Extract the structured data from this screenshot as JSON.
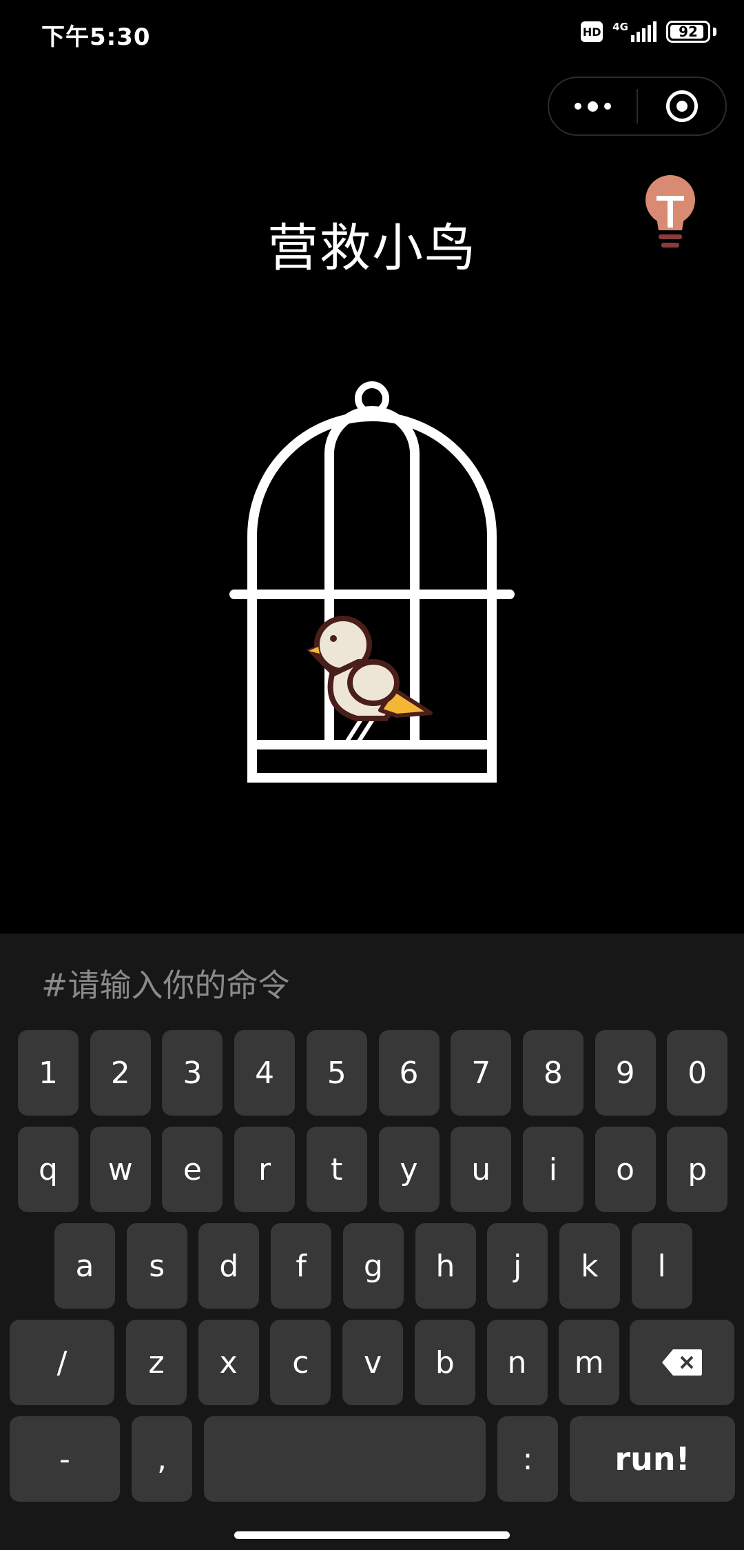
{
  "status_bar": {
    "time": "下午5:30",
    "hd": "HD",
    "network": "4G",
    "battery": "92",
    "battery_fraction": 0.92
  },
  "capsule": {
    "menu_icon": "more-dots-icon",
    "close_icon": "target-circle-icon"
  },
  "hint_icon": "lightbulb-icon",
  "game": {
    "title": "营救小鸟",
    "illustration": "birdcage-icon"
  },
  "command": {
    "placeholder": "#请输入你的命令",
    "value": ""
  },
  "keyboard": {
    "row1": [
      "1",
      "2",
      "3",
      "4",
      "5",
      "6",
      "7",
      "8",
      "9",
      "0"
    ],
    "row2": [
      "q",
      "w",
      "e",
      "r",
      "t",
      "y",
      "u",
      "i",
      "o",
      "p"
    ],
    "row3": [
      "a",
      "s",
      "d",
      "f",
      "g",
      "h",
      "j",
      "k",
      "l"
    ],
    "row4": [
      "/",
      "z",
      "x",
      "c",
      "v",
      "b",
      "n",
      "m"
    ],
    "backspace_icon": "backspace-icon",
    "row5": {
      "dash": "-",
      "comma": ",",
      "space": "",
      "colon": ":",
      "run": "run!"
    }
  },
  "colors": {
    "background": "#000000",
    "keyboard_bg": "#171717",
    "key_bg": "#383838",
    "bulb": "#d98a72",
    "bird_wing_accent": "#f5b638",
    "bird_outline": "#4a1e1a"
  }
}
